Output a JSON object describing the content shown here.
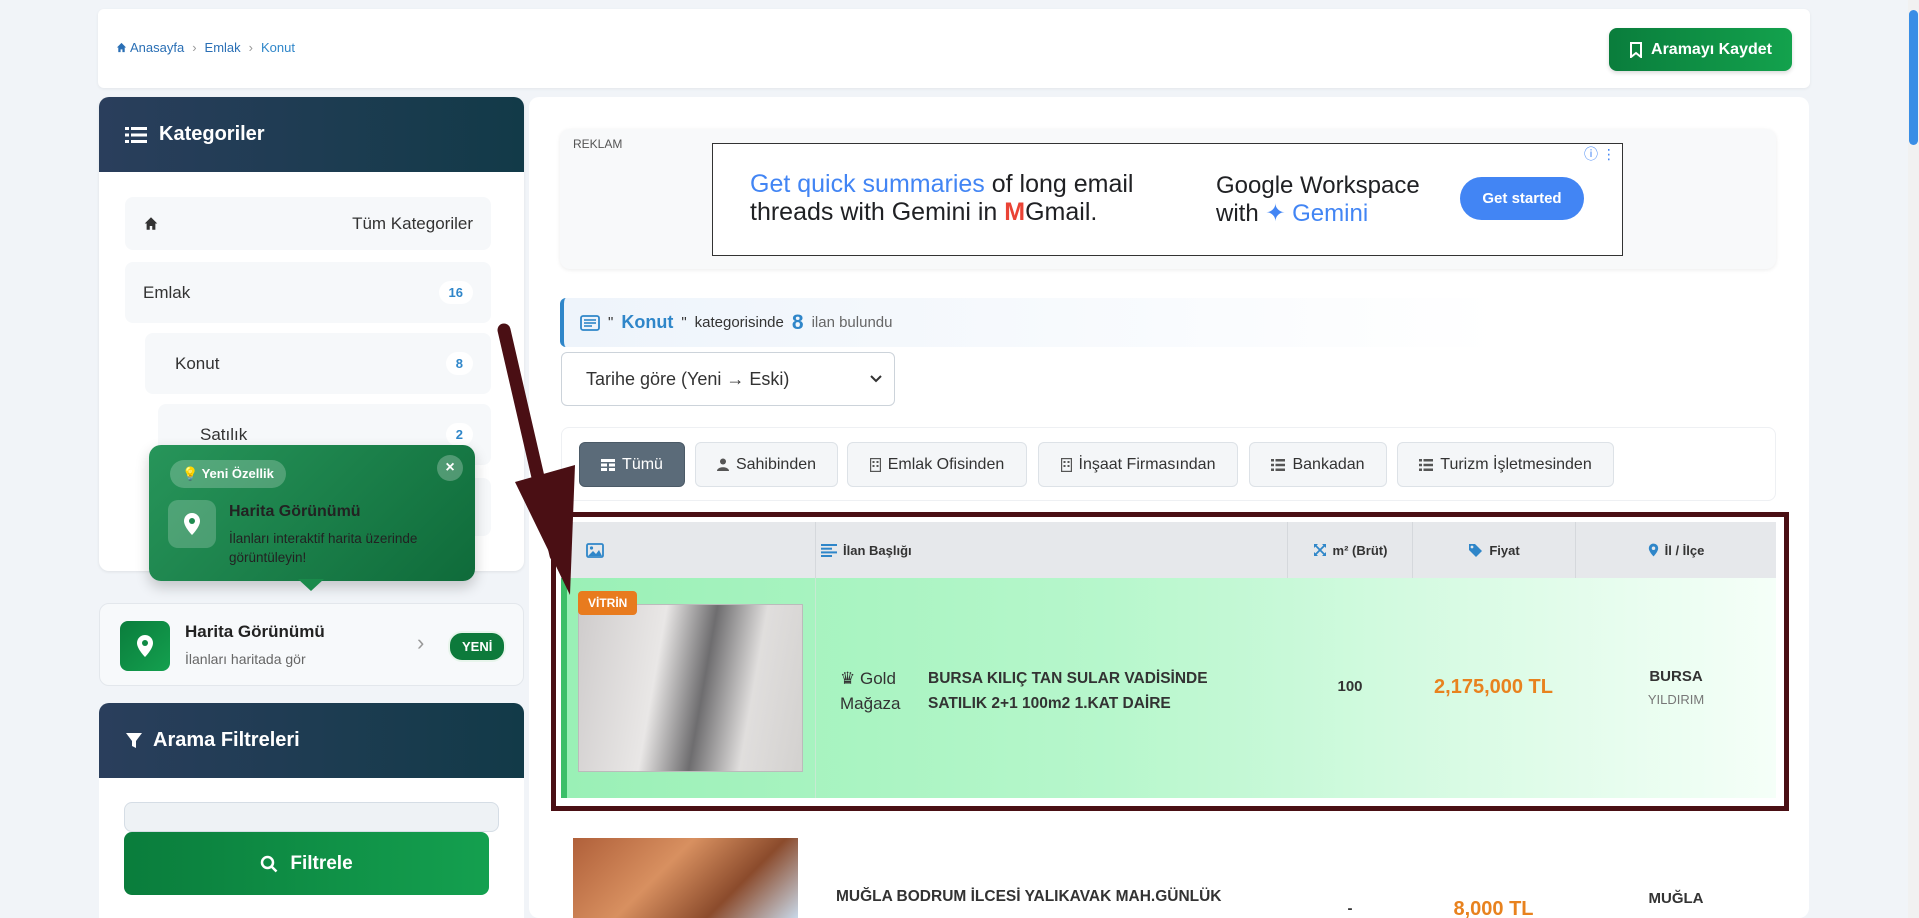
{
  "breadcrumb": {
    "home": "Anasayfa",
    "level1": "Emlak",
    "current": "Konut"
  },
  "header": {
    "save_search": "Aramayı Kaydet"
  },
  "sidebar": {
    "title": "Kategoriler",
    "all_categories": "Tüm Kategoriler",
    "items": [
      {
        "label": "Emlak",
        "count": "16"
      },
      {
        "label": "Konut",
        "count": "8"
      },
      {
        "label": "Satılık",
        "count": "2"
      }
    ]
  },
  "tooltip": {
    "badge": "Yeni Özellik",
    "title": "Harita Görünümü",
    "desc": "İlanları interaktif harita üzerinde görüntüleyin!",
    "close": "×"
  },
  "map_card": {
    "title": "Harita Görünümü",
    "subtitle": "İlanları haritada gör",
    "badge": "YENİ"
  },
  "filters": {
    "title": "Arama Filtreleri",
    "button": "Filtrele"
  },
  "ad": {
    "label": "REKLAM",
    "line1_blue": "Get quick summaries",
    "line1_rest": " of long email",
    "line2": "threads with Gemini in",
    "line2_gmail": "Gmail.",
    "brand1": "Google Workspace",
    "brand2_pre": "with ",
    "brand2_blue": "Gemini",
    "cta": "Get started"
  },
  "results": {
    "quote_open": "\"",
    "category": "Konut",
    "quote_close": "\"",
    "in_text": "kategorisinde",
    "count": "8",
    "found_text": "ilan bulundu"
  },
  "sort": {
    "selected": "Tarihe göre (Yeni → Eski)"
  },
  "tabs": [
    {
      "label": "Tümü"
    },
    {
      "label": "Sahibinden"
    },
    {
      "label": "Emlak Ofisinden"
    },
    {
      "label": "İnşaat Firmasından"
    },
    {
      "label": "Bankadan"
    },
    {
      "label": "Turizm İşletmesinden"
    }
  ],
  "table": {
    "headers": {
      "title": "İlan Başlığı",
      "m2": "m² (Brüt)",
      "price": "Fiyat",
      "location": "İl / İlçe"
    },
    "rows": [
      {
        "badge": "VİTRİN",
        "store": "Gold",
        "store2": "Mağaza",
        "title": "BURSA KILIÇ TAN SULAR VADİSİNDE SATILIK 2+1 100m2 1.KAT DAİRE",
        "m2": "100",
        "price": "2,175,000 TL",
        "city": "BURSA",
        "district": "YILDIRIM"
      },
      {
        "title": "MUĞLA BODRUM İLCESİ YALIKAVAK MAH.GÜNLÜK",
        "m2": "-",
        "price": "8,000 TL",
        "city": "MUĞLA"
      }
    ]
  },
  "colors": {
    "accent_green": "#0a7d3c",
    "accent_blue": "#2f86c9",
    "price_orange": "#e8821e",
    "highlight_border": "#4a0f14"
  }
}
